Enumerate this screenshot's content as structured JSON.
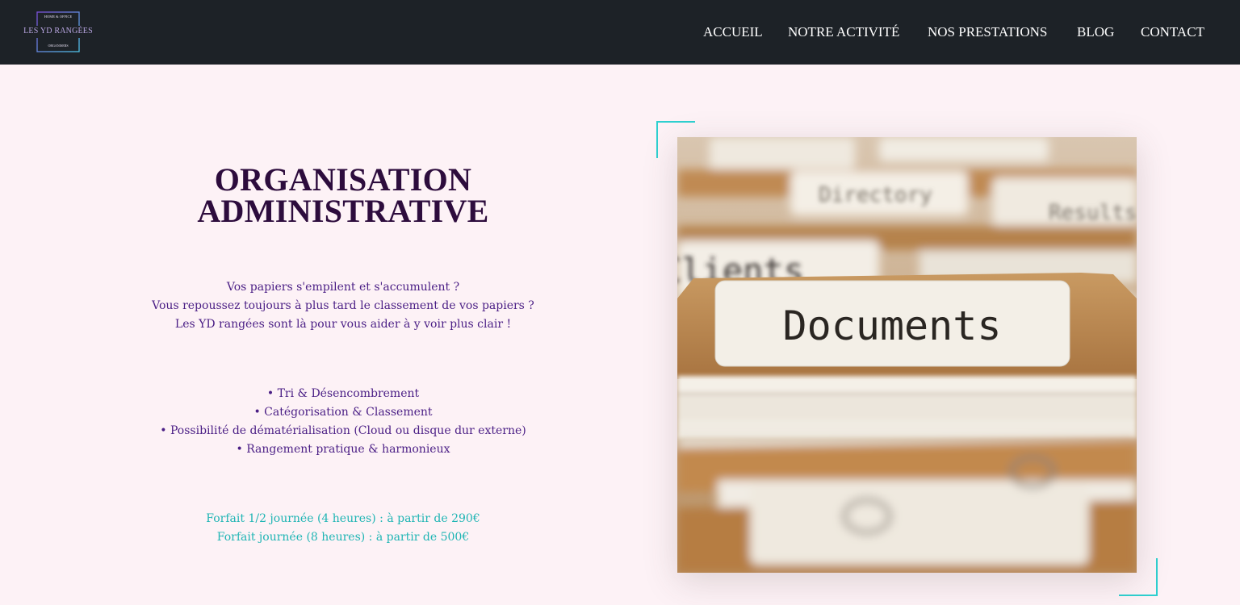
{
  "logo": {
    "top_text": "HOME & OFFICE",
    "main_text": "LES YD RANGÉES",
    "bottom_text": "ORGANISERS"
  },
  "nav": {
    "items": [
      {
        "label": "ACCUEIL"
      },
      {
        "label": "NOTRE ACTIVITÉ"
      },
      {
        "label": "NOS PRESTATIONS"
      },
      {
        "label": "BLOG"
      },
      {
        "label": "CONTACT"
      }
    ]
  },
  "main": {
    "title_lines": [
      "ORGANISATION",
      "ADMINISTRATIVE"
    ],
    "intro_lines": [
      "Vos papiers s'empilent et s'accumulent ?",
      "Vous repoussez toujours à plus tard le classement de vos papiers ?",
      "Les YD rangées sont là pour vous aider à y voir plus clair !"
    ],
    "bullets": [
      "• Tri & Désencombrement",
      "• Catégorisation & Classement",
      "• Possibilité de dématérialisation (Cloud ou disque dur externe)",
      "• Rangement pratique & harmonieux"
    ],
    "prices": [
      "Forfait 1/2 journée (4 heures) : à partir de 290€",
      "Forfait journée (8 heures) : à partir de 500€"
    ]
  },
  "image": {
    "label_text": "Documents",
    "background_tabs": [
      "Directory",
      "Results",
      "Clients"
    ]
  },
  "colors": {
    "header_bg": "#1d2227",
    "page_bg": "#fdf2f6",
    "title": "#2d0c3d",
    "body_text": "#4a1e85",
    "price_text": "#1fb5b4",
    "frame_accent": "#2fd0d0"
  }
}
